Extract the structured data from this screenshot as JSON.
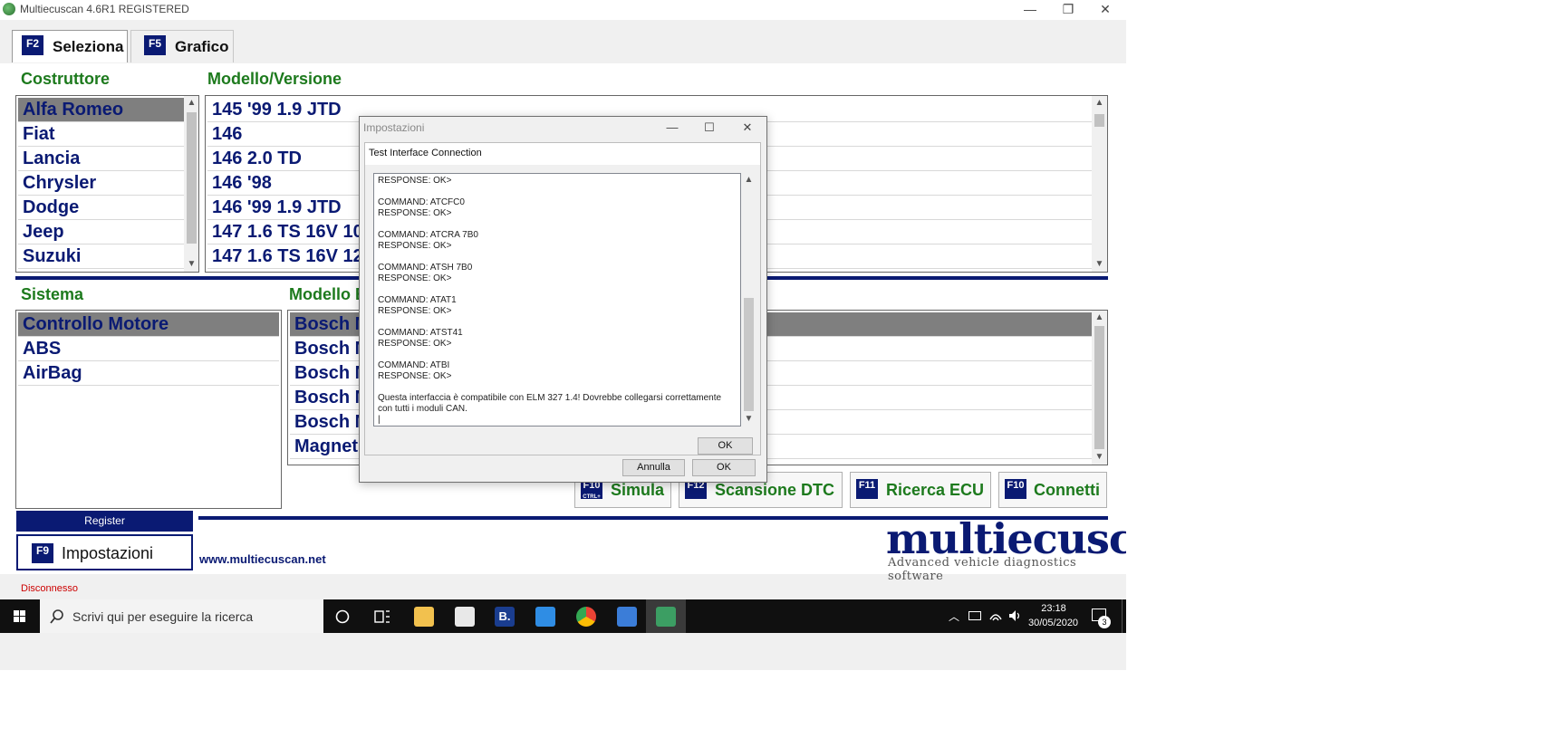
{
  "window": {
    "title": "Multiecuscan 4.6R1 REGISTERED",
    "controls": [
      "—",
      "❐",
      "✕"
    ]
  },
  "tabs": [
    {
      "key": "F2",
      "label": "Seleziona"
    },
    {
      "key": "F5",
      "label": "Grafico"
    }
  ],
  "manufacturer": {
    "heading": "Costruttore",
    "items": [
      "Alfa Romeo",
      "Fiat",
      "Lancia",
      "Chrysler",
      "Dodge",
      "Jeep",
      "Suzuki"
    ],
    "selected": "Alfa Romeo"
  },
  "model": {
    "heading": "Modello/Versione",
    "items": [
      "145 '99 1.9 JTD",
      "146",
      "146 2.0 TD",
      "146 '98",
      "146 '99 1.9 JTD",
      "147 1.6 TS 16V 10",
      "147 1.6 TS 16V 12"
    ]
  },
  "system": {
    "heading": "Sistema",
    "items": [
      "Controllo Motore",
      "ABS",
      "AirBag"
    ],
    "selected": "Controllo Motore"
  },
  "ecu_model": {
    "heading": "Modello E",
    "items": [
      "Bosch M",
      "Bosch M",
      "Bosch M",
      "Bosch M",
      "Bosch M",
      "Magneti"
    ]
  },
  "action_buttons": [
    {
      "key": "F10",
      "subkey": "CTRL+",
      "label": "Simula"
    },
    {
      "key": "F12",
      "label": "Scansione DTC"
    },
    {
      "key": "F11",
      "label": "Ricerca ECU"
    },
    {
      "key": "F10",
      "label": "Connetti"
    }
  ],
  "register_label": "Register",
  "settings_button": {
    "key": "F9",
    "label": "Impostazioni"
  },
  "website": "www.multiecuscan.net",
  "logo": {
    "name": "multiecuscan",
    "tagline": "Advanced vehicle diagnostics software"
  },
  "status": "Disconnesso",
  "dialog": {
    "title": "Impostazioni",
    "group_title": "Test Interface Connection",
    "log": "RESPONSE: OK>\n\nCOMMAND: ATCFC0\nRESPONSE: OK>\n\nCOMMAND: ATCRA 7B0\nRESPONSE: OK>\n\nCOMMAND: ATSH 7B0\nRESPONSE: OK>\n\nCOMMAND: ATAT1\nRESPONSE: OK>\n\nCOMMAND: ATST41\nRESPONSE: OK>\n\nCOMMAND: ATBI\nRESPONSE: OK>\n\nQuesta interfaccia è compatibile con ELM 327 1.4! Dovrebbe collegarsi correttamente con tutti i moduli CAN.\n|",
    "inner_ok": "OK",
    "cancel": "Annulla",
    "ok": "OK"
  },
  "taskbar": {
    "search_placeholder": "Scrivi qui per eseguire la ricerca",
    "time": "23:18",
    "date": "30/05/2020",
    "notifications": "3",
    "pinned_icons": [
      "cortana-icon",
      "task-view-icon",
      "file-explorer-icon",
      "store-icon",
      "booking-icon",
      "mail-icon",
      "chrome-icon",
      "app-window-icon",
      "multiecuscan-icon"
    ],
    "booking_letter": "B."
  },
  "colors": {
    "navy": "#0a1a73",
    "green": "#1d7a1d",
    "selection": "#7f7f7f",
    "status_red": "#cc0000"
  }
}
